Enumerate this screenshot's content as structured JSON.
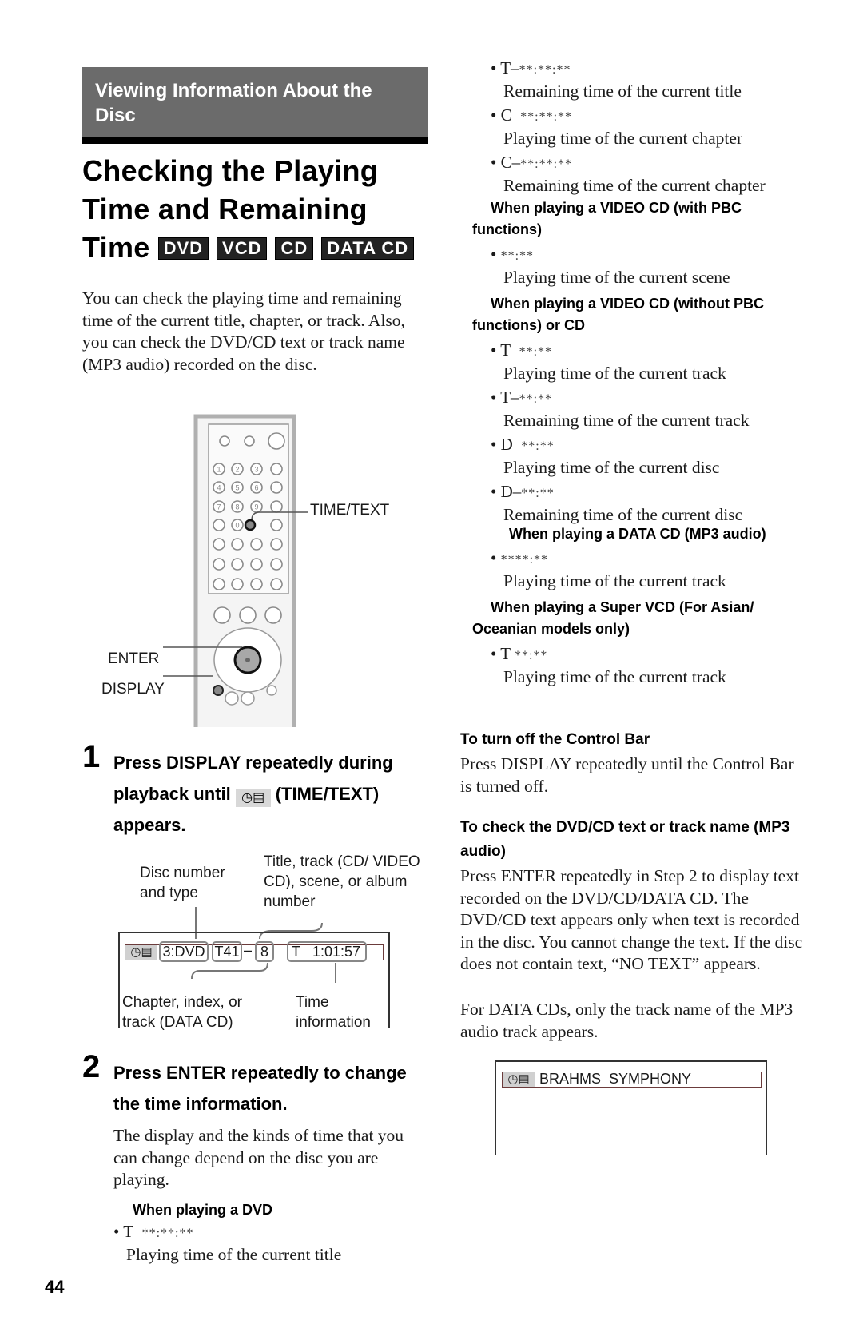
{
  "section_header": "Viewing Information About the Disc",
  "title": {
    "lines": [
      "Checking the Playing",
      "Time and Remaining",
      "Time"
    ],
    "badges": [
      "DVD",
      "VCD",
      "CD",
      "DATA CD"
    ]
  },
  "intro": "You can check the playing time and remaining time of the current title, chapter, or track. Also, you can check the DVD/CD text or track name (MP3 audio) recorded on the disc.",
  "remote_labels": {
    "time_text": "TIME/TEXT",
    "enter": "ENTER",
    "display": "DISPLAY"
  },
  "remote_keys": [
    "1",
    "2",
    "3",
    "4",
    "5",
    "6",
    "7",
    "8",
    "9",
    "0"
  ],
  "step1": {
    "number": "1",
    "text_before": "Press DISPLAY repeatedly during playback until",
    "icon": "time-text-icon",
    "text_after": "(TIME/TEXT) appears."
  },
  "osd_diagram": {
    "label_disc": "Disc number and type",
    "label_title": "Title, track (CD/ VIDEO CD), scene, or album number",
    "label_chapter": "Chapter, index, or track (DATA CD)",
    "label_time": "Time information",
    "fields": {
      "disc": "3:DVD",
      "title": "T41",
      "separator": "–",
      "chapter": "8",
      "time_prefix": "T",
      "time": "1:01:57"
    }
  },
  "step2": {
    "number": "2",
    "text": "Press ENTER repeatedly to change the time information.",
    "body": "The display and the kinds of time that you can change depend on the disc you are playing."
  },
  "dvd": {
    "heading": "When playing a DVD",
    "items": [
      {
        "prefix": "T",
        "stars": "**:**:**",
        "desc": "Playing time of the current title"
      },
      {
        "prefix": "T–",
        "stars": "**:**:**",
        "desc": "Remaining time of the current title"
      },
      {
        "prefix": "C",
        "stars": "**:**:**",
        "desc": "Playing time of the current chapter"
      },
      {
        "prefix": "C–",
        "stars": "**:**:**",
        "desc": "Remaining time of the current chapter"
      }
    ]
  },
  "vcd_pbc": {
    "heading": "When playing a VIDEO CD (with PBC functions)",
    "items": [
      {
        "prefix": "",
        "stars": "**:**",
        "desc": "Playing time of the current scene"
      }
    ]
  },
  "vcd_nopbc": {
    "heading": "When playing a VIDEO CD (without PBC functions) or CD",
    "items": [
      {
        "prefix": "T",
        "stars": "**:**",
        "desc": "Playing time of the current track"
      },
      {
        "prefix": "T–",
        "stars": "**:**",
        "desc": "Remaining time of the current track"
      },
      {
        "prefix": "D",
        "stars": "**:**",
        "desc": "Playing time of the current disc"
      },
      {
        "prefix": "D–",
        "stars": "**:**",
        "desc": "Remaining time of the current disc"
      }
    ]
  },
  "datacd": {
    "heading": "When playing a DATA CD (MP3 audio)",
    "items": [
      {
        "prefix": "",
        "stars": "****:**",
        "desc": "Playing time of the current track"
      }
    ]
  },
  "svcd": {
    "heading": "When playing a Super VCD (For Asian/ Oceanian models only)",
    "items": [
      {
        "prefix": "T",
        "stars": "**:**",
        "desc": "Playing time of the current track"
      }
    ]
  },
  "tip_control_bar": {
    "heading": "To turn off the Control Bar",
    "body": "Press DISPLAY repeatedly until the Control Bar is turned off."
  },
  "tip_text": {
    "heading": "To check the DVD/CD text or track name (MP3 audio)",
    "body1": "Press ENTER repeatedly in Step 2 to display text recorded on the DVD/CD/DATA CD. The DVD/CD text appears only when text is recorded in the disc. You cannot change the text. If the disc does not contain text, “NO TEXT” appears.",
    "body2": "For DATA CDs, only the track name of the MP3 audio track appears."
  },
  "text_osd": {
    "value": "BRAHMS  SYMPHONY"
  },
  "page_number": "44"
}
